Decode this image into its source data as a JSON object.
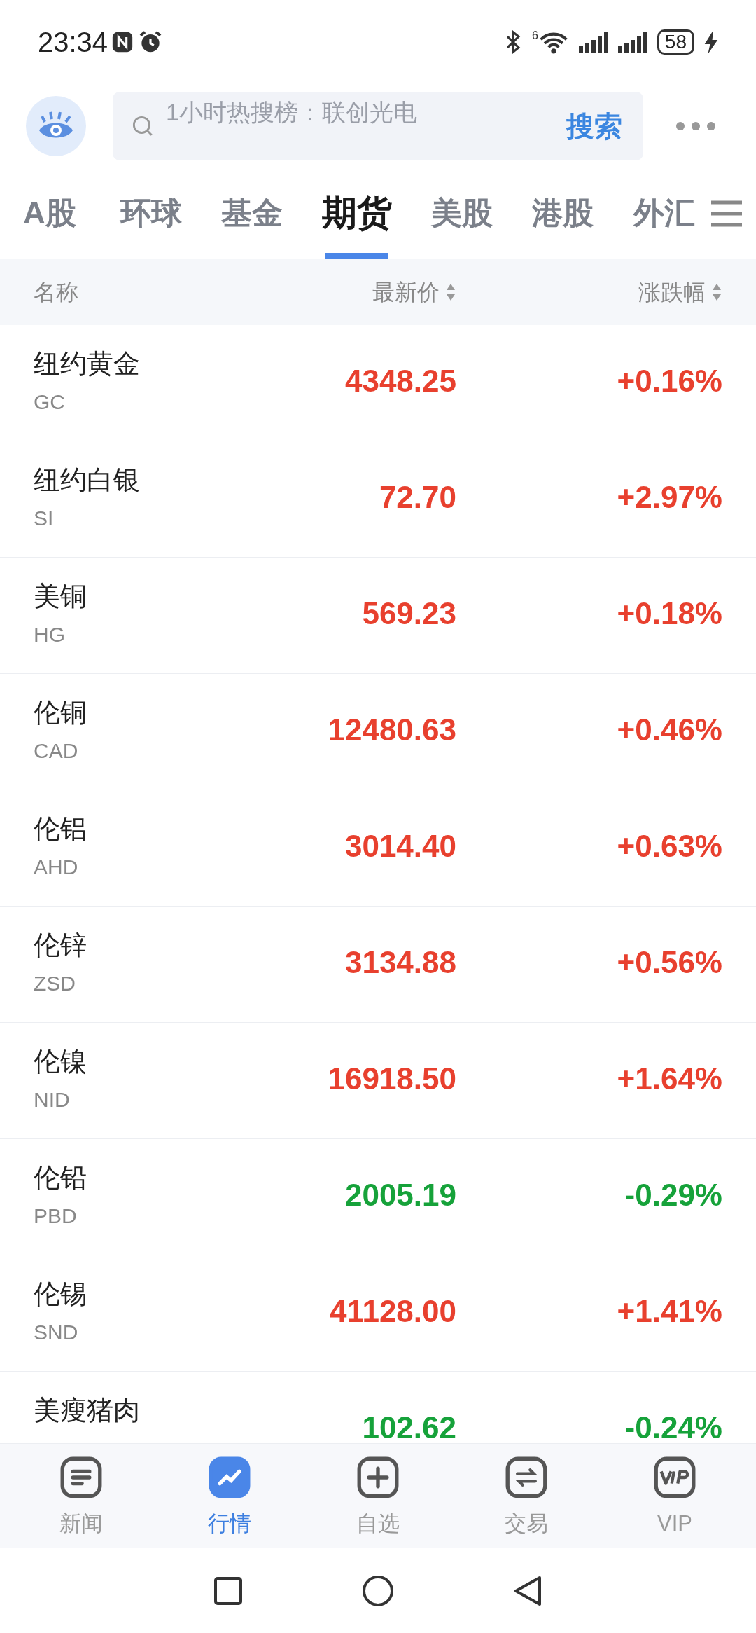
{
  "status_bar": {
    "time": "23:34",
    "battery": "58",
    "wifi_badge": "6"
  },
  "header": {
    "search": {
      "placeholder": "1小时热搜榜：联创光电",
      "button": "搜索"
    }
  },
  "tabs": [
    {
      "label": "A股",
      "selected": false
    },
    {
      "label": "环球",
      "selected": false
    },
    {
      "label": "基金",
      "selected": false
    },
    {
      "label": "期货",
      "selected": true
    },
    {
      "label": "美股",
      "selected": false
    },
    {
      "label": "港股",
      "selected": false
    },
    {
      "label": "外汇",
      "selected": false
    }
  ],
  "table": {
    "columns": [
      "名称",
      "最新价",
      "涨跌幅"
    ],
    "rows": [
      {
        "name": "纽约黄金",
        "code": "GC",
        "price": "4348.25",
        "change": "+0.16%",
        "kind": "up"
      },
      {
        "name": "纽约白银",
        "code": "SI",
        "price": "72.70",
        "change": "+2.97%",
        "kind": "up"
      },
      {
        "name": "美铜",
        "code": "HG",
        "price": "569.23",
        "change": "+0.18%",
        "kind": "up"
      },
      {
        "name": "伦铜",
        "code": "CAD",
        "price": "12480.63",
        "change": "+0.46%",
        "kind": "up"
      },
      {
        "name": "伦铝",
        "code": "AHD",
        "price": "3014.40",
        "change": "+0.63%",
        "kind": "up"
      },
      {
        "name": "伦锌",
        "code": "ZSD",
        "price": "3134.88",
        "change": "+0.56%",
        "kind": "up"
      },
      {
        "name": "伦镍",
        "code": "NID",
        "price": "16918.50",
        "change": "+1.64%",
        "kind": "up"
      },
      {
        "name": "伦铅",
        "code": "PBD",
        "price": "2005.19",
        "change": "-0.29%",
        "kind": "down"
      },
      {
        "name": "伦锡",
        "code": "SND",
        "price": "41128.00",
        "change": "+1.41%",
        "kind": "up"
      },
      {
        "name": "美瘦猪肉",
        "price": "102.62",
        "change": "-0.24%",
        "kind": "down"
      }
    ]
  },
  "bottom_nav": [
    {
      "label": "新闻",
      "selected": false
    },
    {
      "label": "行情",
      "selected": true
    },
    {
      "label": "自选",
      "selected": false
    },
    {
      "label": "交易",
      "selected": false
    },
    {
      "label": "VIP",
      "selected": false
    }
  ]
}
